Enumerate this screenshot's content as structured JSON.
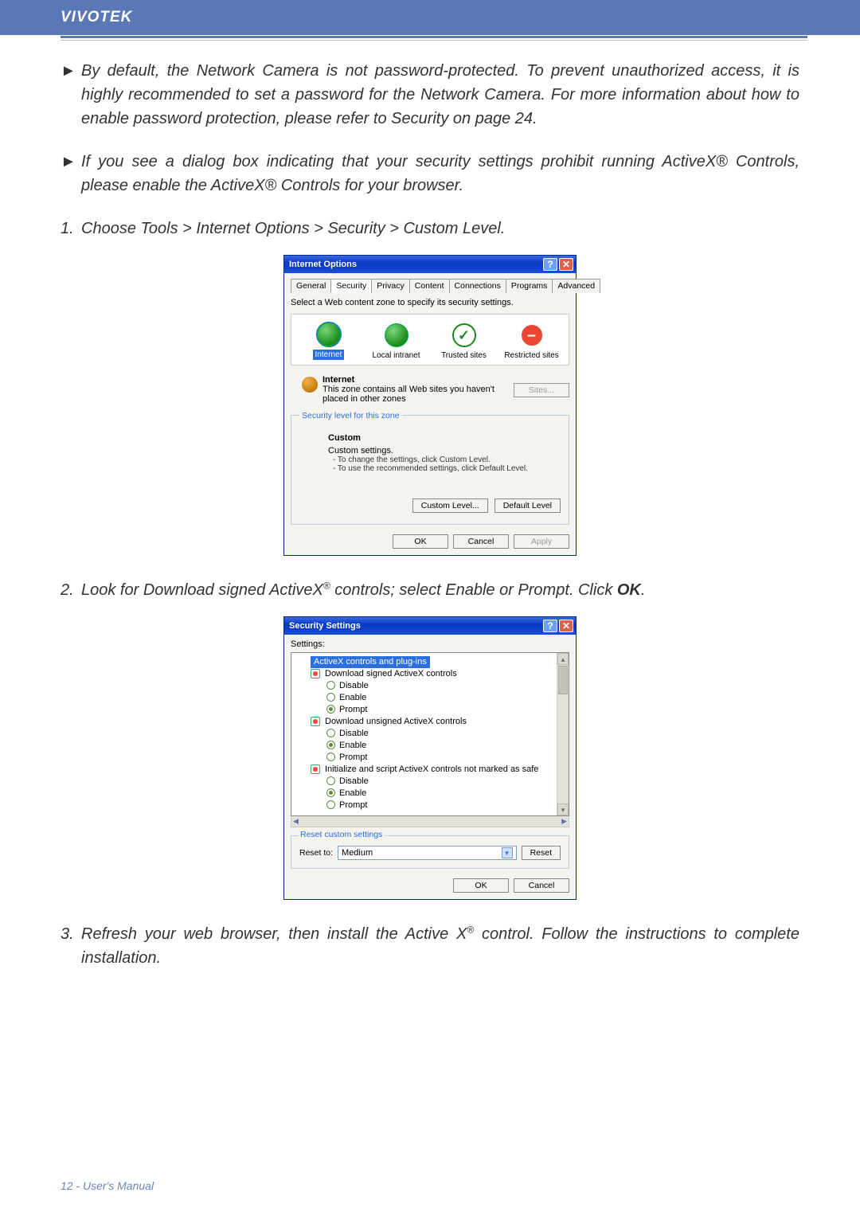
{
  "header": {
    "brand": "VIVOTEK"
  },
  "bullets": [
    "By default, the Network Camera is not password-protected. To prevent unauthorized access, it is highly recommended to set a password for the Network Camera. For more information about how to enable password protection, please refer to Security on page 24.",
    "If you see a dialog box indicating that your security settings prohibit running ActiveX® Controls, please enable the ActiveX® Controls for your browser."
  ],
  "steps": {
    "s1": "Choose Tools > Internet Options > Security > Custom Level.",
    "s2_a": "Look for Download signed ActiveX",
    "s2_b": " controls; select Enable or Prompt. Click ",
    "s2_ok": "OK",
    "s2_c": ".",
    "s3_a": "Refresh your web browser, then install the Active X",
    "s3_b": " control. Follow the instructions to complete installation."
  },
  "dlg1": {
    "title": "Internet Options",
    "tabs": [
      "General",
      "Security",
      "Privacy",
      "Content",
      "Connections",
      "Programs",
      "Advanced"
    ],
    "hint": "Select a Web content zone to specify its security settings.",
    "zones": [
      {
        "label": "Internet",
        "type": "globe",
        "selected": true
      },
      {
        "label": "Local intranet",
        "type": "globe"
      },
      {
        "label": "Trusted sites",
        "type": "check"
      },
      {
        "label": "Restricted sites",
        "type": "minus"
      }
    ],
    "zone_title": "Internet",
    "zone_desc": "This zone contains all Web sites you haven't placed in other zones",
    "sites_btn": "Sites...",
    "fs_title": "Security level for this zone",
    "custom_title": "Custom",
    "custom_sub": "Custom settings.",
    "custom_li1": "- To change the settings, click Custom Level.",
    "custom_li2": "- To use the recommended settings, click Default Level.",
    "btn_custom": "Custom Level...",
    "btn_default": "Default Level",
    "btn_ok": "OK",
    "btn_cancel": "Cancel",
    "btn_apply": "Apply"
  },
  "dlg2": {
    "title": "Security Settings",
    "settings_label": "Settings:",
    "items": [
      {
        "lvl": 1,
        "txt": "ActiveX controls and plug-ins",
        "icon": "gear",
        "hl": true
      },
      {
        "lvl": 2,
        "txt": "Download signed ActiveX controls",
        "icon": "gear"
      },
      {
        "lvl": 3,
        "txt": "Disable",
        "radio": true,
        "sel": false
      },
      {
        "lvl": 3,
        "txt": "Enable",
        "radio": true,
        "sel": false
      },
      {
        "lvl": 3,
        "txt": "Prompt",
        "radio": true,
        "sel": true
      },
      {
        "lvl": 2,
        "txt": "Download unsigned ActiveX controls",
        "icon": "gear"
      },
      {
        "lvl": 3,
        "txt": "Disable",
        "radio": true,
        "sel": false
      },
      {
        "lvl": 3,
        "txt": "Enable",
        "radio": true,
        "sel": true
      },
      {
        "lvl": 3,
        "txt": "Prompt",
        "radio": true,
        "sel": false
      },
      {
        "lvl": 2,
        "txt": "Initialize and script ActiveX controls not marked as safe",
        "icon": "gear"
      },
      {
        "lvl": 3,
        "txt": "Disable",
        "radio": true,
        "sel": false
      },
      {
        "lvl": 3,
        "txt": "Enable",
        "radio": true,
        "sel": true
      },
      {
        "lvl": 3,
        "txt": "Prompt",
        "radio": true,
        "sel": false
      }
    ],
    "reset_title": "Reset custom settings",
    "reset_to": "Reset to:",
    "reset_value": "Medium",
    "btn_reset": "Reset",
    "btn_ok": "OK",
    "btn_cancel": "Cancel"
  },
  "footer": "12 - User's Manual"
}
